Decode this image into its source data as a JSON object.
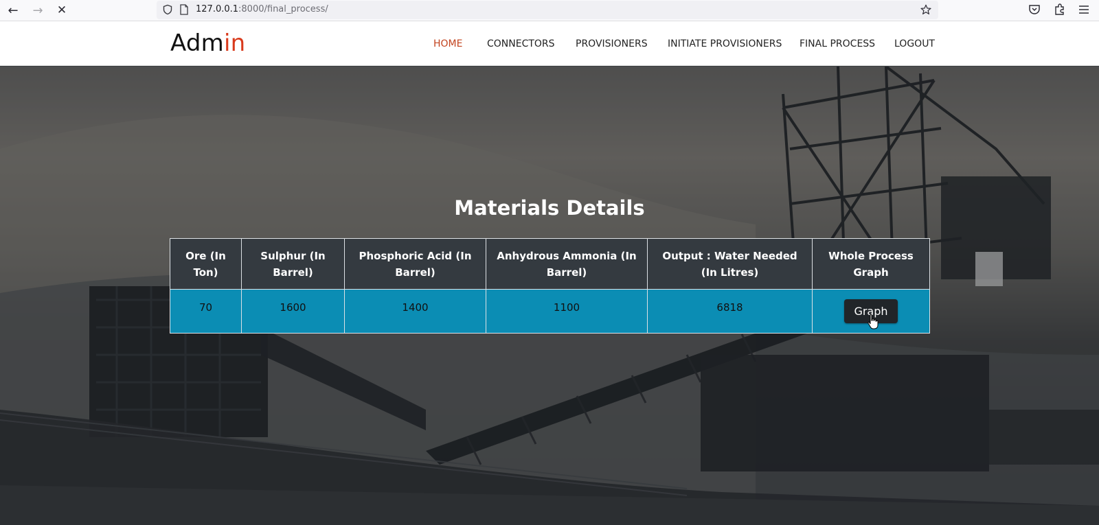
{
  "browser": {
    "url_host": "127.0.0.1",
    "url_rest": ":8000/final_process/"
  },
  "header": {
    "brand_main": "Adm",
    "brand_accent": "in",
    "nav": [
      {
        "label": "HOME",
        "active": true
      },
      {
        "label": "CONNECTORS",
        "active": false
      },
      {
        "label": "PROVISIONERS",
        "active": false
      },
      {
        "label": "INITIATE PROVISIONERS",
        "active": false
      },
      {
        "label": "FINAL PROCESS",
        "active": false
      },
      {
        "label": "LOGOUT",
        "active": false
      }
    ]
  },
  "main": {
    "title": "Materials Details",
    "table": {
      "headers": [
        "Ore (In Ton)",
        "Sulphur (In Barrel)",
        "Phosphoric Acid (In Barrel)",
        "Anhydrous Ammonia (In Barrel)",
        "Output : Water Needed (In Litres)",
        "Whole Process Graph"
      ],
      "row": [
        "70",
        "1600",
        "1400",
        "1100",
        "6818"
      ],
      "button_label": "Graph"
    }
  },
  "colors": {
    "accent": "#d93a1c",
    "nav_active": "#c2431e",
    "table_header_bg": "#343a40",
    "table_row_bg": "#0b8db4",
    "button_bg": "#212529"
  },
  "icons": [
    "back-icon",
    "forward-icon",
    "stop-icon",
    "shield-icon",
    "page-icon",
    "star-icon",
    "pocket-icon",
    "extensions-icon",
    "menu-icon",
    "pointer-cursor-icon"
  ]
}
